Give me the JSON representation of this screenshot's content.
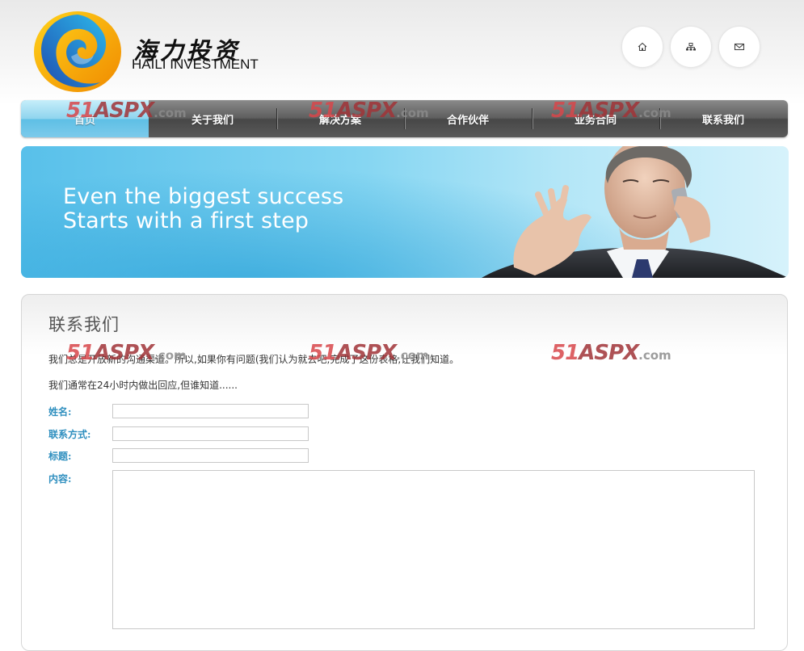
{
  "header": {
    "logo_cn": "海力投资",
    "logo_en": "HAILI INVESTMENT",
    "tools": [
      {
        "icon": "home-icon"
      },
      {
        "icon": "sitemap-icon"
      },
      {
        "icon": "mail-icon"
      }
    ]
  },
  "nav": {
    "items": [
      {
        "label": "首页",
        "active": true
      },
      {
        "label": "关于我们"
      },
      {
        "label": "解决方案"
      },
      {
        "label": "合作伙伴"
      },
      {
        "label": "业务合同"
      },
      {
        "label": "联系我们"
      }
    ]
  },
  "banner": {
    "line1": "Even the biggest success",
    "line2": "Starts with a first step"
  },
  "contact": {
    "title": "联系我们",
    "intro1": "我们总是开放新的沟通渠道。所以,如果你有问题(我们认为就去吧,完成了这份表格,让我们知道。",
    "intro2": "我们通常在24小时内做出回应,但谁知道......",
    "fields": {
      "name_label": "姓名:",
      "name_value": "",
      "contact_label": "联系方式:",
      "contact_value": "",
      "subject_label": "标题:",
      "subject_value": "",
      "content_label": "内容:",
      "content_value": ""
    }
  },
  "watermark": {
    "part1": "51",
    "part2": "ASPX",
    "part3": ".com"
  },
  "colors": {
    "label_blue": "#2f8fbf",
    "nav_active": "#8fd4ee",
    "banner_blue": "#58c0ea"
  }
}
